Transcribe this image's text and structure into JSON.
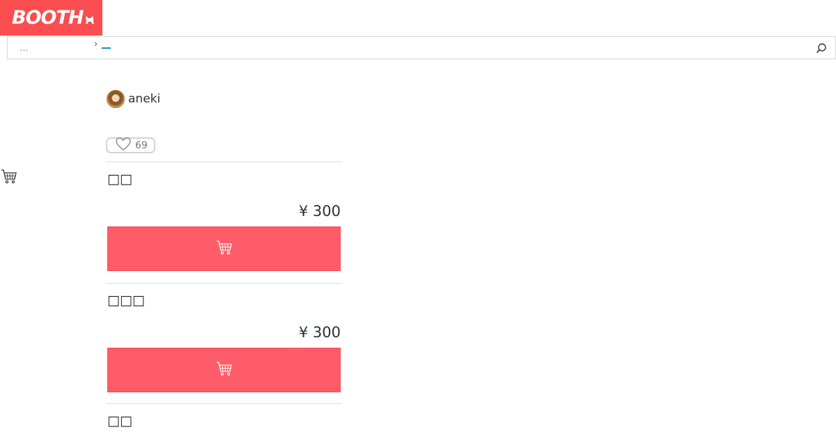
{
  "brand": {
    "logo_text": "BOOTH",
    "accent": "#fc4d50"
  },
  "search": {
    "placeholder": "…",
    "breadcrumb_sep": "›",
    "breadcrumb_link": "__"
  },
  "shop": {
    "name": "aneki"
  },
  "like": {
    "count": "69"
  },
  "variations": [
    {
      "name": "□□",
      "price": "¥ 300"
    },
    {
      "name": "□□□",
      "price": "¥ 300"
    },
    {
      "name": "□□"
    }
  ],
  "icons": {
    "search": "search-icon",
    "cart": "cart-icon",
    "heart": "heart-icon"
  },
  "colors": {
    "cart_button": "#ff5c69",
    "link": "#0b93c7"
  }
}
